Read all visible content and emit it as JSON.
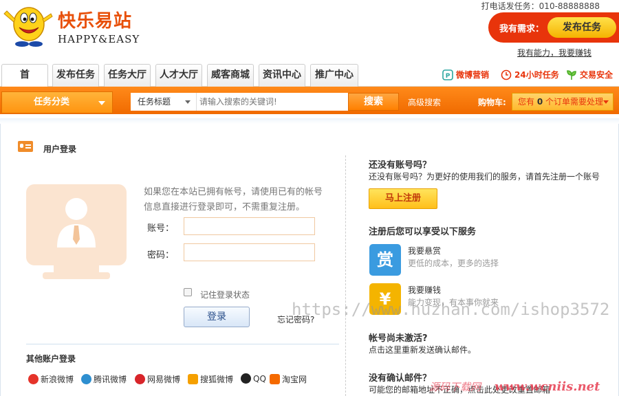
{
  "brand": {
    "name_cn": "快乐易站",
    "name_en": "HAPPY&EASY"
  },
  "header": {
    "phone_text": "打电话发任务：010-88888888",
    "need_text": "我有需求：",
    "publish_label": "发布任务",
    "earn_link": "我有能力，我要赚钱"
  },
  "nav": {
    "tabs": [
      "首",
      "发布任务",
      "任务大厅",
      "人才大厅",
      "威客商城",
      "资讯中心",
      "推广中心"
    ],
    "badges": [
      "微博营销",
      "24小时任务",
      "交易安全"
    ]
  },
  "search": {
    "category_label": "任务分类",
    "type_select": "任务标题",
    "placeholder": "请输入搜索的关键词!",
    "button_label": "搜索",
    "advanced_label": "高级搜索",
    "cart_label": "购物车:",
    "cart_prefix": "您有",
    "cart_count": "0",
    "cart_suffix": "个订单需要处理"
  },
  "login": {
    "heading": "用户登录",
    "hint": "如果您在本站已拥有帐号，请使用已有的帐号信息直接进行登录即可，不需重复注册。",
    "account_label": "账号：",
    "password_label": "密码：",
    "remember_label": "记住登录状态",
    "login_button": "登录",
    "forgot_label": "忘记密码?",
    "other_heading": "其他账户登录",
    "social": [
      {
        "label": "新浪微博",
        "color": "#e5332a"
      },
      {
        "label": "腾讯微博",
        "color": "#2e8fd0"
      },
      {
        "label": "网易微博",
        "color": "#d8252a"
      },
      {
        "label": "搜狐微博",
        "color": "#f5a000"
      },
      {
        "label": "QQ",
        "color": "#222222"
      },
      {
        "label": "淘宝网",
        "color": "#f56a00"
      }
    ]
  },
  "register": {
    "q_heading": "还没有账号吗？",
    "q_text": "还没有账号吗？为更好的使用我们的服务，请首先注册一个账号",
    "register_button": "马上注册",
    "services_heading": "注册后您可以享受以下服务",
    "services": [
      {
        "glyph": "赏",
        "title": "我要悬赏",
        "subtitle": "更低的成本，更多的选择",
        "color": "#3a9be0"
      },
      {
        "glyph": "¥",
        "title": "我要赚钱",
        "subtitle": "能力变现，有本事你就来",
        "color": "#f4b400"
      }
    ],
    "not_activated_heading": "帐号尚未激活?",
    "not_activated_text": "点击这里重新发送确认邮件。",
    "no_email_heading": "没有确认邮件？",
    "no_email_text": "可能您的邮箱地址不正确，点击此处更改重置邮箱"
  },
  "watermarks": {
    "main": "https://www.huzhan.com/ishop3572",
    "cn": "源码下载网",
    "site": "www.wcniis.net"
  },
  "colors": {
    "brand_orange": "#ff8a1a",
    "brand_red": "#e8340b"
  }
}
